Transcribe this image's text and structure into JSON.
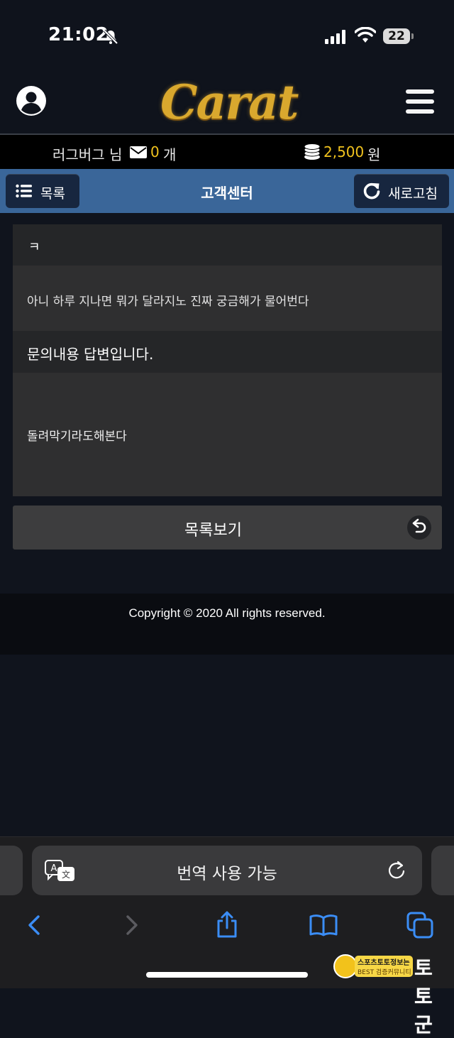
{
  "status_bar": {
    "time": "21:02",
    "battery": "22"
  },
  "header": {
    "logo_text": "Carat"
  },
  "info_bar": {
    "username": "러그버그 님",
    "message_count": "0",
    "message_unit": "개",
    "balance": "2,500",
    "balance_unit": "원"
  },
  "nav": {
    "list_label": "목록",
    "title": "고객센터",
    "refresh_label": "새로고침"
  },
  "inquiry": {
    "title": "ㅋ",
    "body": "아니 하루 지나면 뭐가 달라지노 진짜 궁금해가 물어번다",
    "answer_title": "문의내용 답변입니다.",
    "answer_body": "돌려막기라도해본다"
  },
  "back_button": {
    "label": "목록보기"
  },
  "footer": {
    "copyright": "Copyright © 2020 All rights reserved."
  },
  "safari": {
    "address_text": "번역 사용 가능"
  },
  "watermark": {
    "line1": "스포츠토토정보는",
    "line2": "BEST 검증커뮤니티",
    "logo": "토토군"
  },
  "colors": {
    "accent_gold": "#f0c21e",
    "nav_blue": "#3a6699",
    "nav_button": "#17263f",
    "safari_blue": "#3b8df5"
  },
  "icons": [
    "bell-slash-icon",
    "signal-icon",
    "wifi-icon",
    "user-avatar-icon",
    "hamburger-icon",
    "mail-icon",
    "coins-icon",
    "list-icon",
    "refresh-icon",
    "return-icon",
    "translate-icon",
    "reload-icon",
    "back-icon",
    "forward-icon",
    "share-icon",
    "bookmarks-icon",
    "tabs-icon"
  ]
}
